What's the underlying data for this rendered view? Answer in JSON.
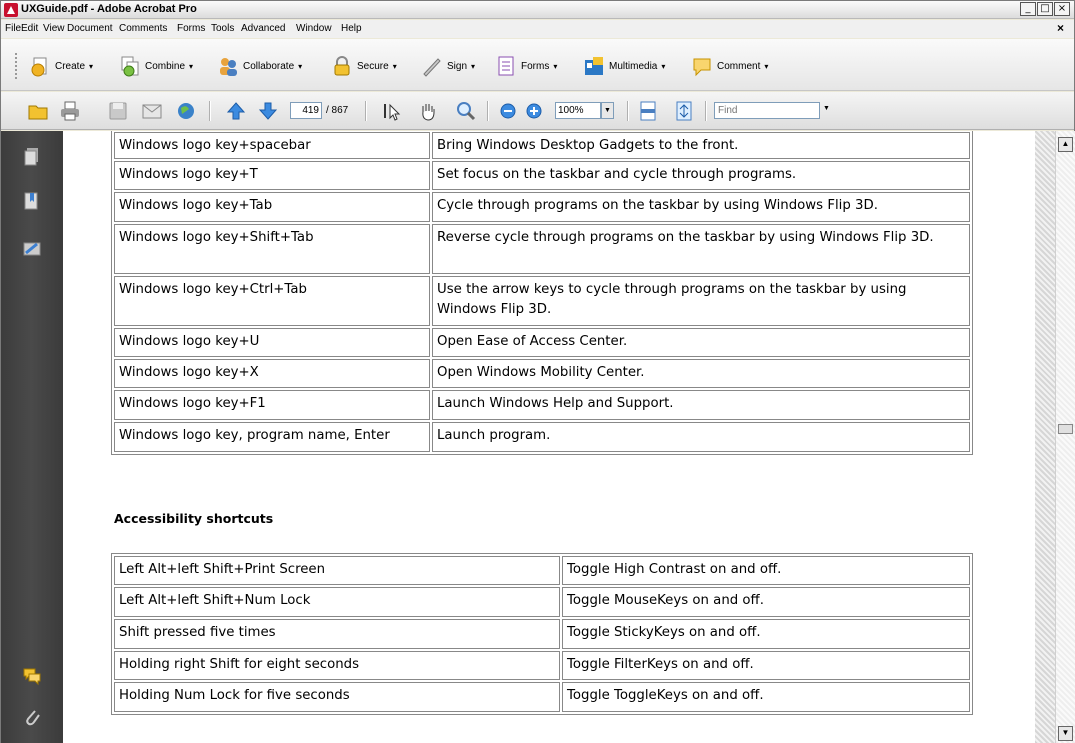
{
  "window": {
    "title": "UXGuide.pdf - Adobe Acrobat Pro",
    "min_label": "_",
    "max_label": "□",
    "close_label": "×"
  },
  "menu": {
    "items": [
      "File",
      "Edit",
      "View",
      "Document",
      "Comments",
      "Forms",
      "Tools",
      "Advanced",
      "Window",
      "Help"
    ],
    "close_doc": "×"
  },
  "task_toolbar": {
    "items": [
      {
        "label": "Create",
        "icon": "create-pdf-icon"
      },
      {
        "label": "Combine",
        "icon": "combine-icon"
      },
      {
        "label": "Collaborate",
        "icon": "collaborate-icon"
      },
      {
        "label": "Secure",
        "icon": "lock-icon"
      },
      {
        "label": "Sign",
        "icon": "pen-icon"
      },
      {
        "label": "Forms",
        "icon": "forms-icon"
      },
      {
        "label": "Multimedia",
        "icon": "multimedia-icon"
      },
      {
        "label": "Comment",
        "icon": "comment-icon"
      }
    ],
    "caret": "▾"
  },
  "nav_toolbar": {
    "current_page": "419",
    "total_pages": "/ 867",
    "zoom": "100%",
    "find_placeholder": "Find"
  },
  "document": {
    "table1": [
      [
        "Windows logo key+spacebar",
        "Bring Windows Desktop Gadgets to the front."
      ],
      [
        "Windows logo key+T",
        "Set focus on the taskbar and cycle through programs."
      ],
      [
        "Windows logo key+Tab",
        "Cycle through programs on the taskbar by using Windows Flip 3D."
      ],
      [
        "Windows logo key+Shift+Tab",
        "Reverse cycle through programs on the taskbar by using Windows Flip 3D."
      ],
      [
        "Windows logo key+Ctrl+Tab",
        "Use the arrow keys to cycle through programs on the taskbar by using Windows Flip 3D."
      ],
      [
        "Windows logo key+U",
        "Open Ease of Access Center."
      ],
      [
        "Windows logo key+X",
        "Open Windows Mobility Center."
      ],
      [
        "Windows logo key+F1",
        "Launch Windows Help and Support."
      ],
      [
        "Windows logo key, program name, Enter",
        "Launch program."
      ]
    ],
    "section_heading": "Accessibility shortcuts",
    "table2": [
      [
        "Left Alt+left Shift+Print Screen",
        "Toggle High Contrast on and off."
      ],
      [
        "Left Alt+left Shift+Num Lock",
        "Toggle MouseKeys on and off."
      ],
      [
        "Shift pressed five times",
        "Toggle StickyKeys on and off."
      ],
      [
        "Holding right Shift for eight seconds",
        "Toggle FilterKeys on and off."
      ],
      [
        "Holding Num Lock for five seconds",
        "Toggle ToggleKeys on and off."
      ]
    ]
  },
  "scrollbar": {
    "up": "▲",
    "down": "▼"
  }
}
